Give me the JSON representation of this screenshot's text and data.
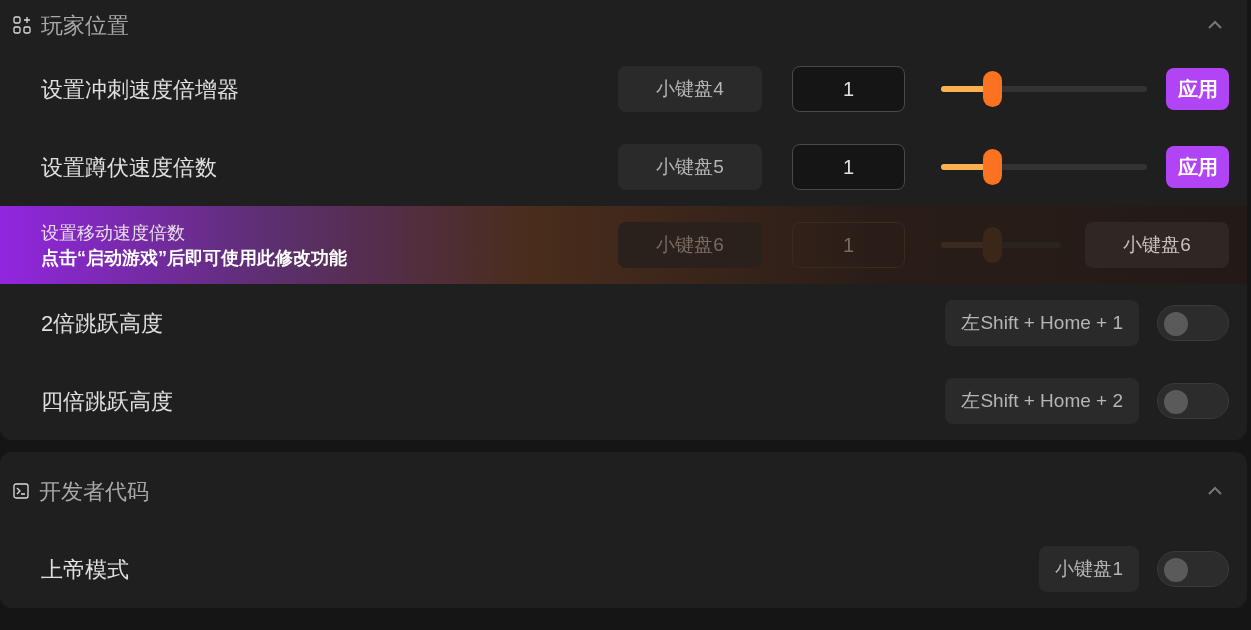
{
  "sections": [
    {
      "title": "玩家位置",
      "expanded": true,
      "rows": [
        {
          "kind": "slider",
          "label": "设置冲刺速度倍增器",
          "hotkey": "小键盘4",
          "value": "1",
          "level": 0.25,
          "apply": "应用"
        },
        {
          "kind": "slider",
          "label": "设置蹲伏速度倍数",
          "hotkey": "小键盘5",
          "value": "1",
          "level": 0.25,
          "apply": "应用"
        },
        {
          "kind": "locked",
          "label": "设置移动速度倍数",
          "message": "点击“启动游戏”后即可使用此修改功能",
          "hotkey": "小键盘6",
          "value": "1",
          "hotkey_right": "小键盘6"
        },
        {
          "kind": "toggle",
          "label": "2倍跳跃高度",
          "hotkey": "左Shift + Home + 1",
          "on": false
        },
        {
          "kind": "toggle",
          "label": "四倍跳跃高度",
          "hotkey": "左Shift + Home + 2",
          "on": false
        }
      ]
    },
    {
      "title": "开发者代码",
      "expanded": true,
      "rows": [
        {
          "kind": "toggle",
          "label": "上帝模式",
          "hotkey": "小键盘1",
          "on": false
        }
      ]
    }
  ]
}
